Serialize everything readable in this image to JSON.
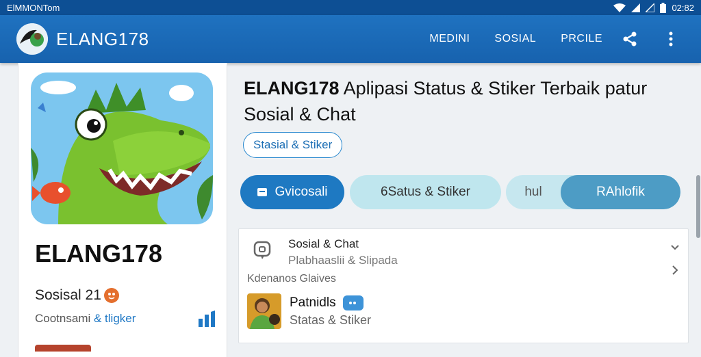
{
  "statusbar": {
    "carrier": "ElMMONTom",
    "time": "02:82"
  },
  "appbar": {
    "brand": "ELANG178",
    "nav": [
      "MEDINI",
      "SOSIAL",
      "PRCILE"
    ]
  },
  "app": {
    "name": "ELANG178",
    "subtitle": "Sosisal 21",
    "meta_prefix": "Cootnsami ",
    "meta_amp": "& tligker"
  },
  "main": {
    "headline_bold": "ELANG178",
    "headline_rest": " Aplipasi Status & Stiker Terbaik patur Sosial & Chat",
    "chip": "Stasial & Stiker",
    "buttons": {
      "primary": "Gvicosali",
      "secondary": "6Satus & Stiker",
      "split_left": "hul",
      "split_right": "RAhlofik"
    }
  },
  "list": {
    "item1_title": "Sosial & Chat",
    "item1_sub": "Plabhaaslii & Slipada",
    "section_label": "Kdenanos Glaives",
    "item2_title": "Patnidls",
    "item2_sub": "Statas & Stiker"
  },
  "colors": {
    "primary": "#1e79c2",
    "appbar": "#1762ae",
    "soft": "#bfe6ee"
  }
}
